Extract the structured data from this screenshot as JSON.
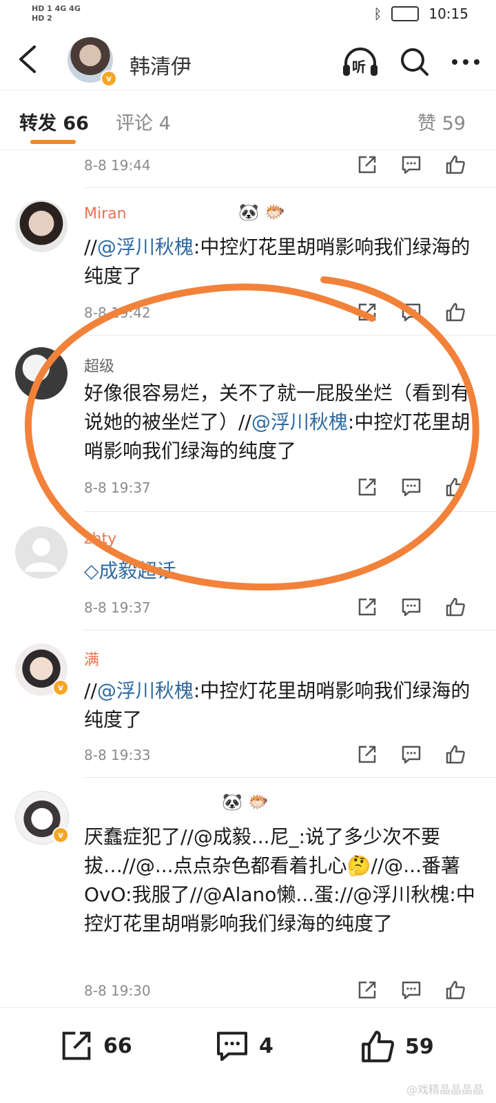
{
  "status": {
    "left_top": "HD 1  4G  4G",
    "left_bottom": "HD 2",
    "time": "10:15"
  },
  "header": {
    "name": "韩清伊",
    "listen_label": "听"
  },
  "tabs": [
    {
      "label": "转发 66"
    },
    {
      "label": "评论 4"
    },
    {
      "label": "赞 59"
    }
  ],
  "posts": [
    {
      "time": "8-8 19:44"
    },
    {
      "name": "Miran",
      "text_pre": "//",
      "mention": "@浮川秋槐",
      "text_post": ":中控灯花里胡哨影响我们绿海的纯度了",
      "time": "8-8 19:42"
    },
    {
      "name": "超级",
      "text_pre": "好像很容易烂，关不了就一屁股坐烂（看到有说她的被坐烂了）//",
      "mention": "@浮川秋槐",
      "text_post": ":中控灯花里胡哨影响我们绿海的纯度了",
      "time": "8-8 19:37"
    },
    {
      "name": "zhty",
      "topic": "成毅超话",
      "time": "8-8 19:37"
    },
    {
      "name": "满",
      "text_pre": "//",
      "mention": "@浮川秋槐",
      "text_post": ":中控灯花里胡哨影响我们绿海的纯度了",
      "time": "8-8 19:33"
    },
    {
      "name": "",
      "text": "厌蠢症犯了//@成毅...尼_:说了多少次不要拔…//@...点点杂色都看着扎心🤔//@...番薯OvO:我服了//@Alano懒...蛋://@浮川秋槐:中控灯花里胡哨影响我们绿海的纯度了",
      "time": "8-8 19:30"
    }
  ],
  "bottom": {
    "repost_count": "66",
    "comment_count": "4",
    "like_count": "59"
  },
  "watermark": "@戏精晶晶晶晶",
  "colors": {
    "accent": "#f08a24",
    "link": "#2f6aa3",
    "name": "#eb7350"
  }
}
